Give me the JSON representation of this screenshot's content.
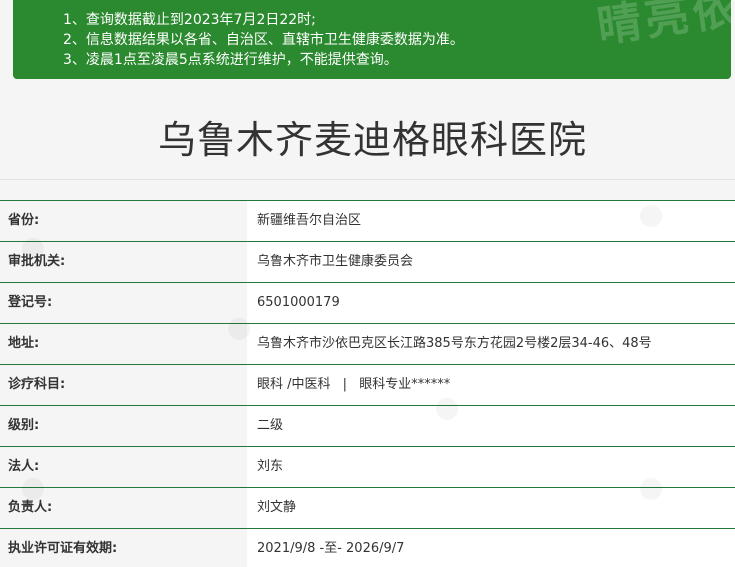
{
  "notice": {
    "lines": [
      "1、查询数据截止到2023年7月2日22时;",
      "2、信息数据结果以各省、自治区、直辖市卫生健康委数据为准。",
      "3、凌晨1点至凌晨5点系统进行维护，不能提供查询。"
    ],
    "watermark": "晴亮依",
    "background_color": "#2b8a2f"
  },
  "hospital": {
    "name": "乌鲁木齐麦迪格眼科医院"
  },
  "rows": [
    {
      "label": "省份:",
      "value": "新疆维吾尔自治区"
    },
    {
      "label": "审批机关:",
      "value": "乌鲁木齐市卫生健康委员会"
    },
    {
      "label": "登记号:",
      "value": "6501000179"
    },
    {
      "label": "地址:",
      "value": "乌鲁木齐市沙依巴克区长江路385号东方花园2号楼2层34-46、48号"
    },
    {
      "label": "诊疗科目:",
      "value_parts": [
        "眼科 /中医科",
        "|",
        "眼科专业******"
      ]
    },
    {
      "label": "级别:",
      "value": "二级"
    },
    {
      "label": "法人:",
      "value": "刘东"
    },
    {
      "label": "负责人:",
      "value": "刘文静"
    },
    {
      "label": "执业许可证有效期:",
      "value": "2021/9/8 -至- 2026/9/7"
    }
  ],
  "colors": {
    "row_border": "#1f7a3c",
    "label_bg": "#f5f5f5",
    "value_bg": "#ffffff"
  }
}
